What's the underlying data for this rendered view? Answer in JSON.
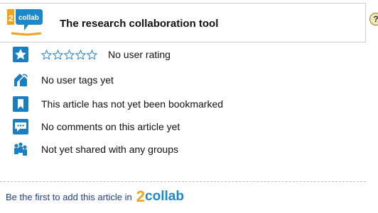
{
  "header": {
    "title": "The research collaboration tool",
    "logo_text": "collab",
    "logo_number": "2",
    "help_glyph": "?"
  },
  "rows": [
    {
      "icon": "star-icon",
      "label": "No user rating",
      "rating_stars_filled": 0,
      "rating_stars_total": 5
    },
    {
      "icon": "tag-icon",
      "label": "No user tags yet"
    },
    {
      "icon": "bookmark-icon",
      "label": "This article has not yet been bookmarked"
    },
    {
      "icon": "comment-icon",
      "label": "No comments on this article yet"
    },
    {
      "icon": "group-icon",
      "label": "Not yet shared with any groups"
    }
  ],
  "footer": {
    "text": "Be the first to add this article in",
    "logo_number": "2",
    "logo_word": "collab"
  },
  "colors": {
    "icon_blue": "#1a7fc1",
    "logo_orange": "#f0a21b",
    "logo_blue": "#1c87c9",
    "footer_text": "#1f3f8f",
    "star_outline": "#1a7fc1"
  }
}
